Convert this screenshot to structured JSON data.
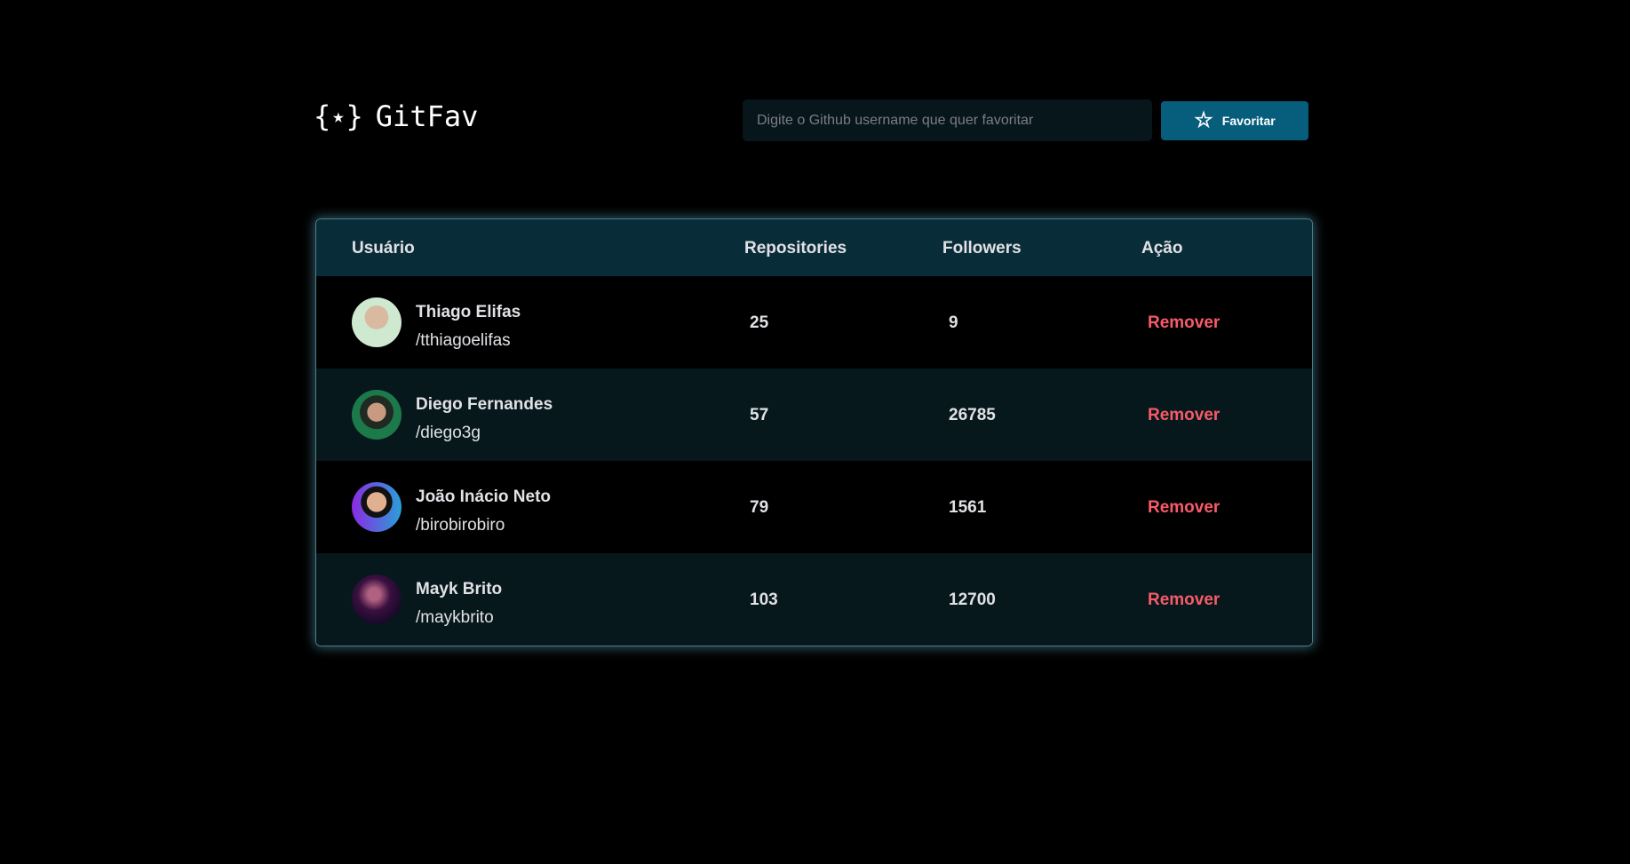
{
  "app": {
    "title": "GitFav",
    "logo_icon": "braces-star-icon"
  },
  "search": {
    "placeholder": "Digite o Github username que quer favoritar",
    "value": ""
  },
  "favorite_button": {
    "label": "Favoritar",
    "icon": "star-outline-icon"
  },
  "table": {
    "headers": [
      "Usuário",
      "Repositories",
      "Followers",
      "Ação"
    ],
    "rows": [
      {
        "name": "Thiago Elifas",
        "login": "/tthiagoelifas",
        "repositories": "25",
        "followers": "9",
        "action": "Remover"
      },
      {
        "name": "Diego Fernandes",
        "login": "/diego3g",
        "repositories": "57",
        "followers": "26785",
        "action": "Remover"
      },
      {
        "name": "João Inácio Neto",
        "login": "/birobirobiro",
        "repositories": "79",
        "followers": "1561",
        "action": "Remover"
      },
      {
        "name": "Mayk Brito",
        "login": "/maykbrito",
        "repositories": "103",
        "followers": "12700",
        "action": "Remover"
      }
    ]
  },
  "colors": {
    "header_bg": "#092D38",
    "row_alt": "#06181C",
    "button": "#065E7C",
    "remove": "#F75A68",
    "text": "#E1E1E6"
  }
}
